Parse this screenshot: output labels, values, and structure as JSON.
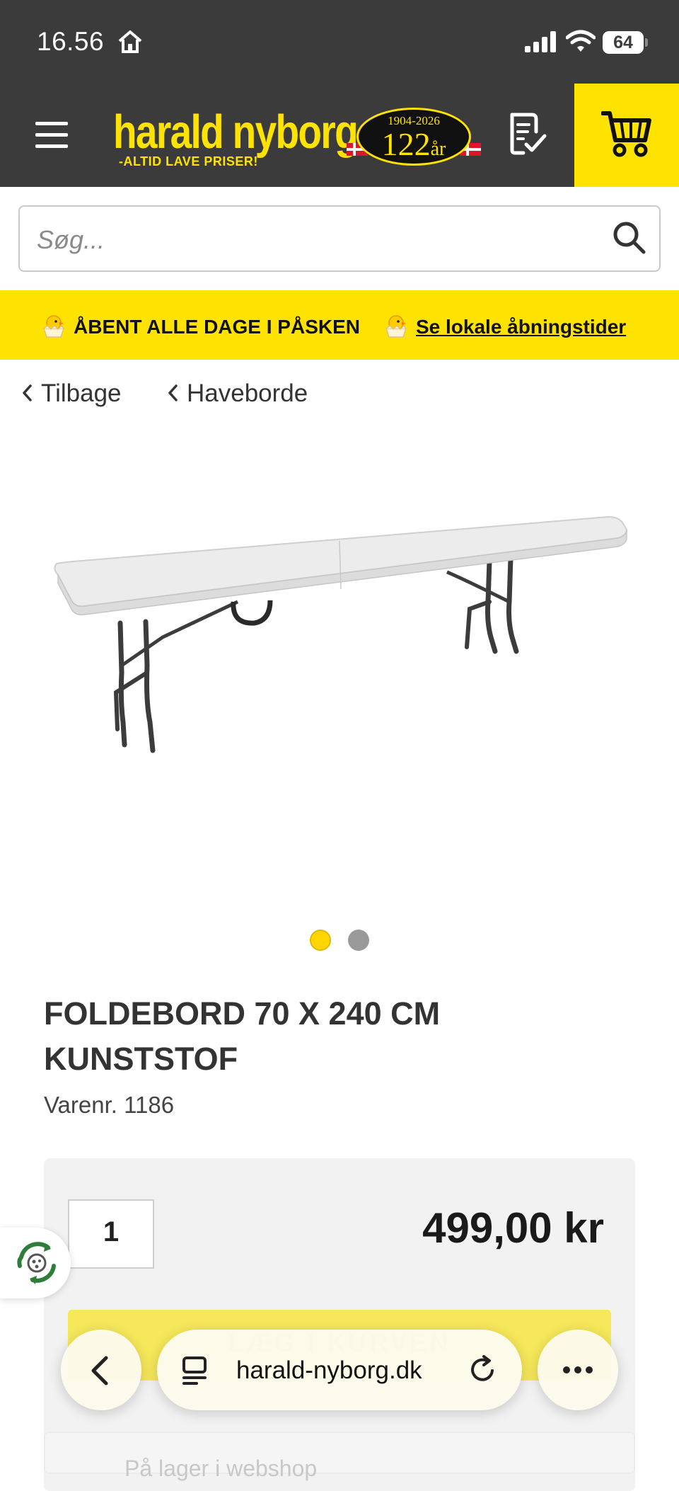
{
  "status_bar": {
    "time": "16.56",
    "battery": "64"
  },
  "header": {
    "brand_name": "harald nyborg",
    "brand_tagline": "-ALTID LAVE PRISER!",
    "anniversary_years": "1904-2026",
    "anniversary_count": "122",
    "anniversary_unit": "år",
    "brand_color": "#ffe300",
    "header_bg": "#3b3b3b"
  },
  "search": {
    "placeholder": "Søg..."
  },
  "banner": {
    "text": "ÅBENT ALLE DAGE I PÅSKEN",
    "link": "Se lokale åbningstider"
  },
  "breadcrumb": {
    "back": "Tilbage",
    "category": "Haveborde"
  },
  "product": {
    "title": "FOLDEBORD 70 X 240 CM KUNSTSTOF",
    "sku": "Varenr. 1186",
    "quantity": "1",
    "price": "499,00 kr",
    "add_to_cart": "LÆG I KURVEN",
    "delivery": "På lager i webshop",
    "image_count": 2,
    "active_image": 1
  },
  "browser": {
    "url": "harald-nyborg.dk"
  }
}
